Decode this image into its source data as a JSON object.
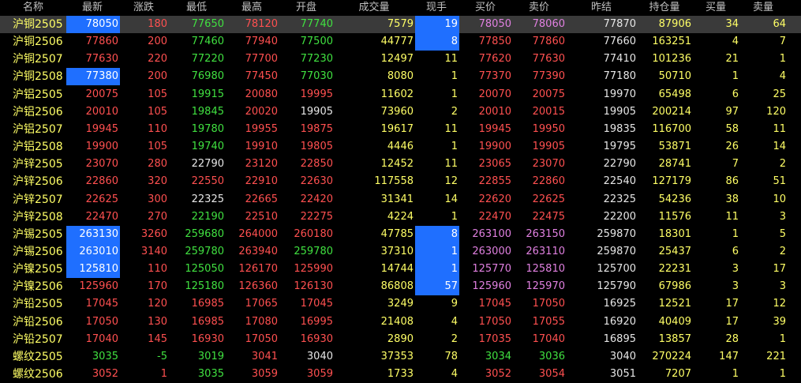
{
  "headers": {
    "name": "名称",
    "last": "最新",
    "change": "涨跌",
    "low": "最低",
    "high": "最高",
    "open": "开盘",
    "volume": "成交量",
    "now_vol": "现手",
    "bid": "买价",
    "ask": "卖价",
    "prev_settle": "昨结",
    "open_interest": "持仓量",
    "bid_qty": "买量",
    "ask_qty": "卖量"
  },
  "colors": {
    "up": "#ff5050",
    "down": "#40e040",
    "flat": "#e6e6e6",
    "name": "#ffff66",
    "highlight": "#1f6fff",
    "selected_row": "#3a3a3a"
  },
  "rows": [
    {
      "name": "沪铜2505",
      "last": "78050",
      "change": "180",
      "low": "77650",
      "high": "78120",
      "open": "77740",
      "volume": "7579",
      "now": "19",
      "bid": "78050",
      "ask": "78060",
      "prev": "77870",
      "oi": "87906",
      "bq": "34",
      "aq": "64"
    },
    {
      "name": "沪铜2506",
      "last": "77860",
      "change": "200",
      "low": "77460",
      "high": "77940",
      "open": "77500",
      "volume": "44777",
      "now": "8",
      "bid": "77850",
      "ask": "77860",
      "prev": "77660",
      "oi": "163251",
      "bq": "4",
      "aq": "7"
    },
    {
      "name": "沪铜2507",
      "last": "77630",
      "change": "220",
      "low": "77220",
      "high": "77700",
      "open": "77230",
      "volume": "12497",
      "now": "11",
      "bid": "77620",
      "ask": "77630",
      "prev": "77410",
      "oi": "101236",
      "bq": "21",
      "aq": "1"
    },
    {
      "name": "沪铜2508",
      "last": "77380",
      "change": "200",
      "low": "76980",
      "high": "77450",
      "open": "77030",
      "volume": "8080",
      "now": "1",
      "bid": "77370",
      "ask": "77390",
      "prev": "77180",
      "oi": "50710",
      "bq": "1",
      "aq": "4"
    },
    {
      "name": "沪铝2505",
      "last": "20075",
      "change": "105",
      "low": "19915",
      "high": "20080",
      "open": "19995",
      "volume": "11602",
      "now": "1",
      "bid": "20070",
      "ask": "20075",
      "prev": "19970",
      "oi": "65498",
      "bq": "6",
      "aq": "25"
    },
    {
      "name": "沪铝2506",
      "last": "20010",
      "change": "105",
      "low": "19845",
      "high": "20020",
      "open": "19905",
      "volume": "73960",
      "now": "2",
      "bid": "20010",
      "ask": "20015",
      "prev": "19905",
      "oi": "200214",
      "bq": "97",
      "aq": "120"
    },
    {
      "name": "沪铝2507",
      "last": "19945",
      "change": "110",
      "low": "19780",
      "high": "19955",
      "open": "19875",
      "volume": "19617",
      "now": "11",
      "bid": "19945",
      "ask": "19950",
      "prev": "19835",
      "oi": "116700",
      "bq": "58",
      "aq": "11"
    },
    {
      "name": "沪铝2508",
      "last": "19900",
      "change": "105",
      "low": "19740",
      "high": "19910",
      "open": "19805",
      "volume": "4446",
      "now": "1",
      "bid": "19900",
      "ask": "19905",
      "prev": "19795",
      "oi": "53871",
      "bq": "26",
      "aq": "14"
    },
    {
      "name": "沪锌2505",
      "last": "23070",
      "change": "280",
      "low": "22790",
      "high": "23120",
      "open": "22850",
      "volume": "12452",
      "now": "11",
      "bid": "23065",
      "ask": "23070",
      "prev": "22790",
      "oi": "28741",
      "bq": "7",
      "aq": "2"
    },
    {
      "name": "沪锌2506",
      "last": "22860",
      "change": "320",
      "low": "22550",
      "high": "22910",
      "open": "22630",
      "volume": "117558",
      "now": "12",
      "bid": "22855",
      "ask": "22860",
      "prev": "22540",
      "oi": "127179",
      "bq": "86",
      "aq": "51"
    },
    {
      "name": "沪锌2507",
      "last": "22625",
      "change": "300",
      "low": "22325",
      "high": "22665",
      "open": "22420",
      "volume": "31341",
      "now": "14",
      "bid": "22620",
      "ask": "22625",
      "prev": "22325",
      "oi": "54236",
      "bq": "38",
      "aq": "10"
    },
    {
      "name": "沪锌2508",
      "last": "22470",
      "change": "270",
      "low": "22190",
      "high": "22510",
      "open": "22275",
      "volume": "4224",
      "now": "1",
      "bid": "22470",
      "ask": "22475",
      "prev": "22200",
      "oi": "11576",
      "bq": "11",
      "aq": "3"
    },
    {
      "name": "沪锡2505",
      "last": "263130",
      "change": "3260",
      "low": "259680",
      "high": "264000",
      "open": "260180",
      "volume": "47785",
      "now": "8",
      "bid": "263100",
      "ask": "263150",
      "prev": "259870",
      "oi": "18301",
      "bq": "1",
      "aq": "5"
    },
    {
      "name": "沪锡2506",
      "last": "263010",
      "change": "3140",
      "low": "259780",
      "high": "263940",
      "open": "259780",
      "volume": "37310",
      "now": "1",
      "bid": "263000",
      "ask": "263110",
      "prev": "259870",
      "oi": "25437",
      "bq": "6",
      "aq": "2"
    },
    {
      "name": "沪镍2505",
      "last": "125810",
      "change": "110",
      "low": "125050",
      "high": "126170",
      "open": "125990",
      "volume": "14744",
      "now": "1",
      "bid": "125770",
      "ask": "125810",
      "prev": "125700",
      "oi": "22231",
      "bq": "3",
      "aq": "17"
    },
    {
      "name": "沪镍2506",
      "last": "125960",
      "change": "170",
      "low": "125180",
      "high": "126360",
      "open": "126130",
      "volume": "86808",
      "now": "57",
      "bid": "125960",
      "ask": "125970",
      "prev": "125790",
      "oi": "67986",
      "bq": "3",
      "aq": "3"
    },
    {
      "name": "沪铅2505",
      "last": "17045",
      "change": "120",
      "low": "16985",
      "high": "17065",
      "open": "17045",
      "volume": "3249",
      "now": "9",
      "bid": "17045",
      "ask": "17050",
      "prev": "16925",
      "oi": "12521",
      "bq": "17",
      "aq": "12"
    },
    {
      "name": "沪铅2506",
      "last": "17050",
      "change": "130",
      "low": "16985",
      "high": "17080",
      "open": "16995",
      "volume": "21408",
      "now": "4",
      "bid": "17050",
      "ask": "17055",
      "prev": "16920",
      "oi": "40409",
      "bq": "17",
      "aq": "39"
    },
    {
      "name": "沪铅2507",
      "last": "17040",
      "change": "145",
      "low": "16930",
      "high": "17050",
      "open": "16930",
      "volume": "2890",
      "now": "2",
      "bid": "17035",
      "ask": "17040",
      "prev": "16895",
      "oi": "13857",
      "bq": "28",
      "aq": "1"
    },
    {
      "name": "螺纹2505",
      "last": "3035",
      "change": "-5",
      "low": "3019",
      "high": "3041",
      "open": "3040",
      "volume": "37353",
      "now": "78",
      "bid": "3034",
      "ask": "3036",
      "prev": "3040",
      "oi": "270224",
      "bq": "147",
      "aq": "221"
    },
    {
      "name": "螺纹2506",
      "last": "3052",
      "change": "1",
      "low": "3035",
      "high": "3059",
      "open": "3059",
      "volume": "1733",
      "now": "4",
      "bid": "3052",
      "ask": "3054",
      "prev": "3051",
      "oi": "7207",
      "bq": "1",
      "aq": "1"
    }
  ]
}
